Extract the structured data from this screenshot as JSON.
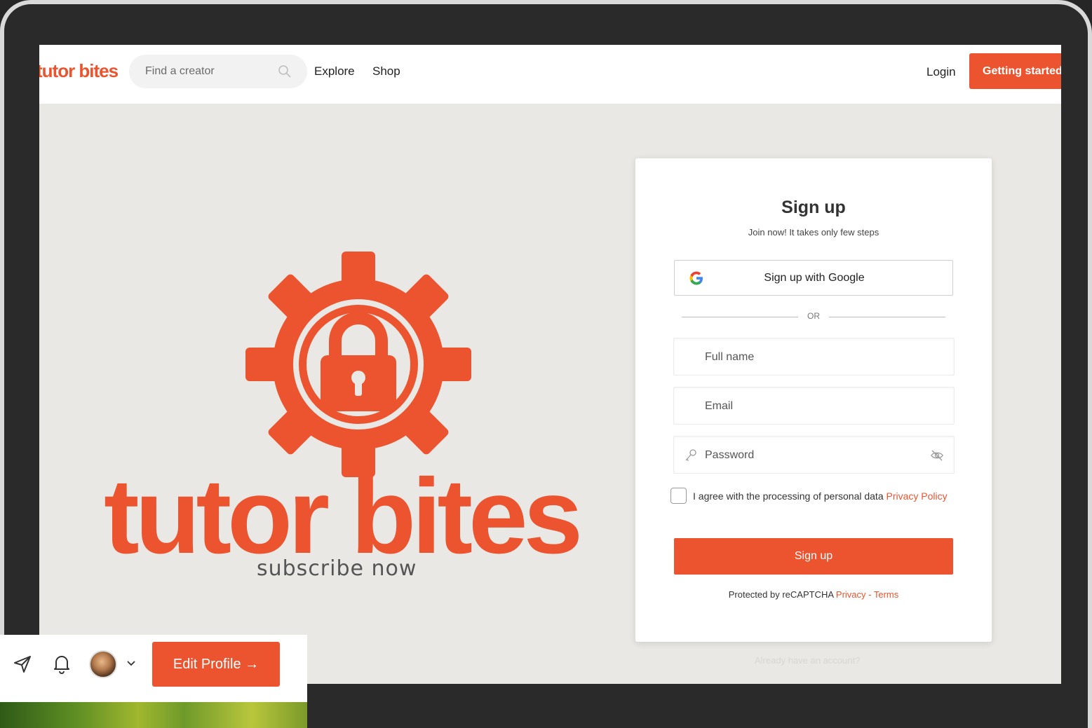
{
  "header": {
    "brand": "tutor bites",
    "search_placeholder": "Find a creator",
    "nav": [
      "Explore",
      "Shop"
    ],
    "login_label": "Login",
    "cta_label": "Getting started"
  },
  "hero": {
    "wordmark": "tutor bites",
    "tagline": "subscribe now",
    "icons": [
      "gear-icon",
      "lock-icon"
    ]
  },
  "signup": {
    "title": "Sign up",
    "subtitle": "Join now! It takes only few steps",
    "google_label": "Sign up with Google",
    "divider": "OR",
    "fields": {
      "full_name_placeholder": "Full name",
      "email_placeholder": "Email",
      "password_placeholder": "Password"
    },
    "agree_text": "I agree with the processing of personal data ",
    "agree_link": "Privacy Policy",
    "submit_label": "Sign up",
    "recaptcha_prefix": "Protected by reCAPTCHA ",
    "recaptcha_privacy": "Privacy",
    "recaptcha_sep": " - ",
    "recaptcha_terms": "Terms",
    "already_account": "Already have an account?"
  },
  "profile_bar": {
    "edit_label": "Edit Profile →",
    "icons": [
      "send-icon",
      "bell-icon",
      "avatar",
      "chevron-down-icon"
    ]
  },
  "colors": {
    "accent": "#ec5430",
    "frame": "#2a2a2a",
    "page_bg": "#e9e8e4"
  }
}
